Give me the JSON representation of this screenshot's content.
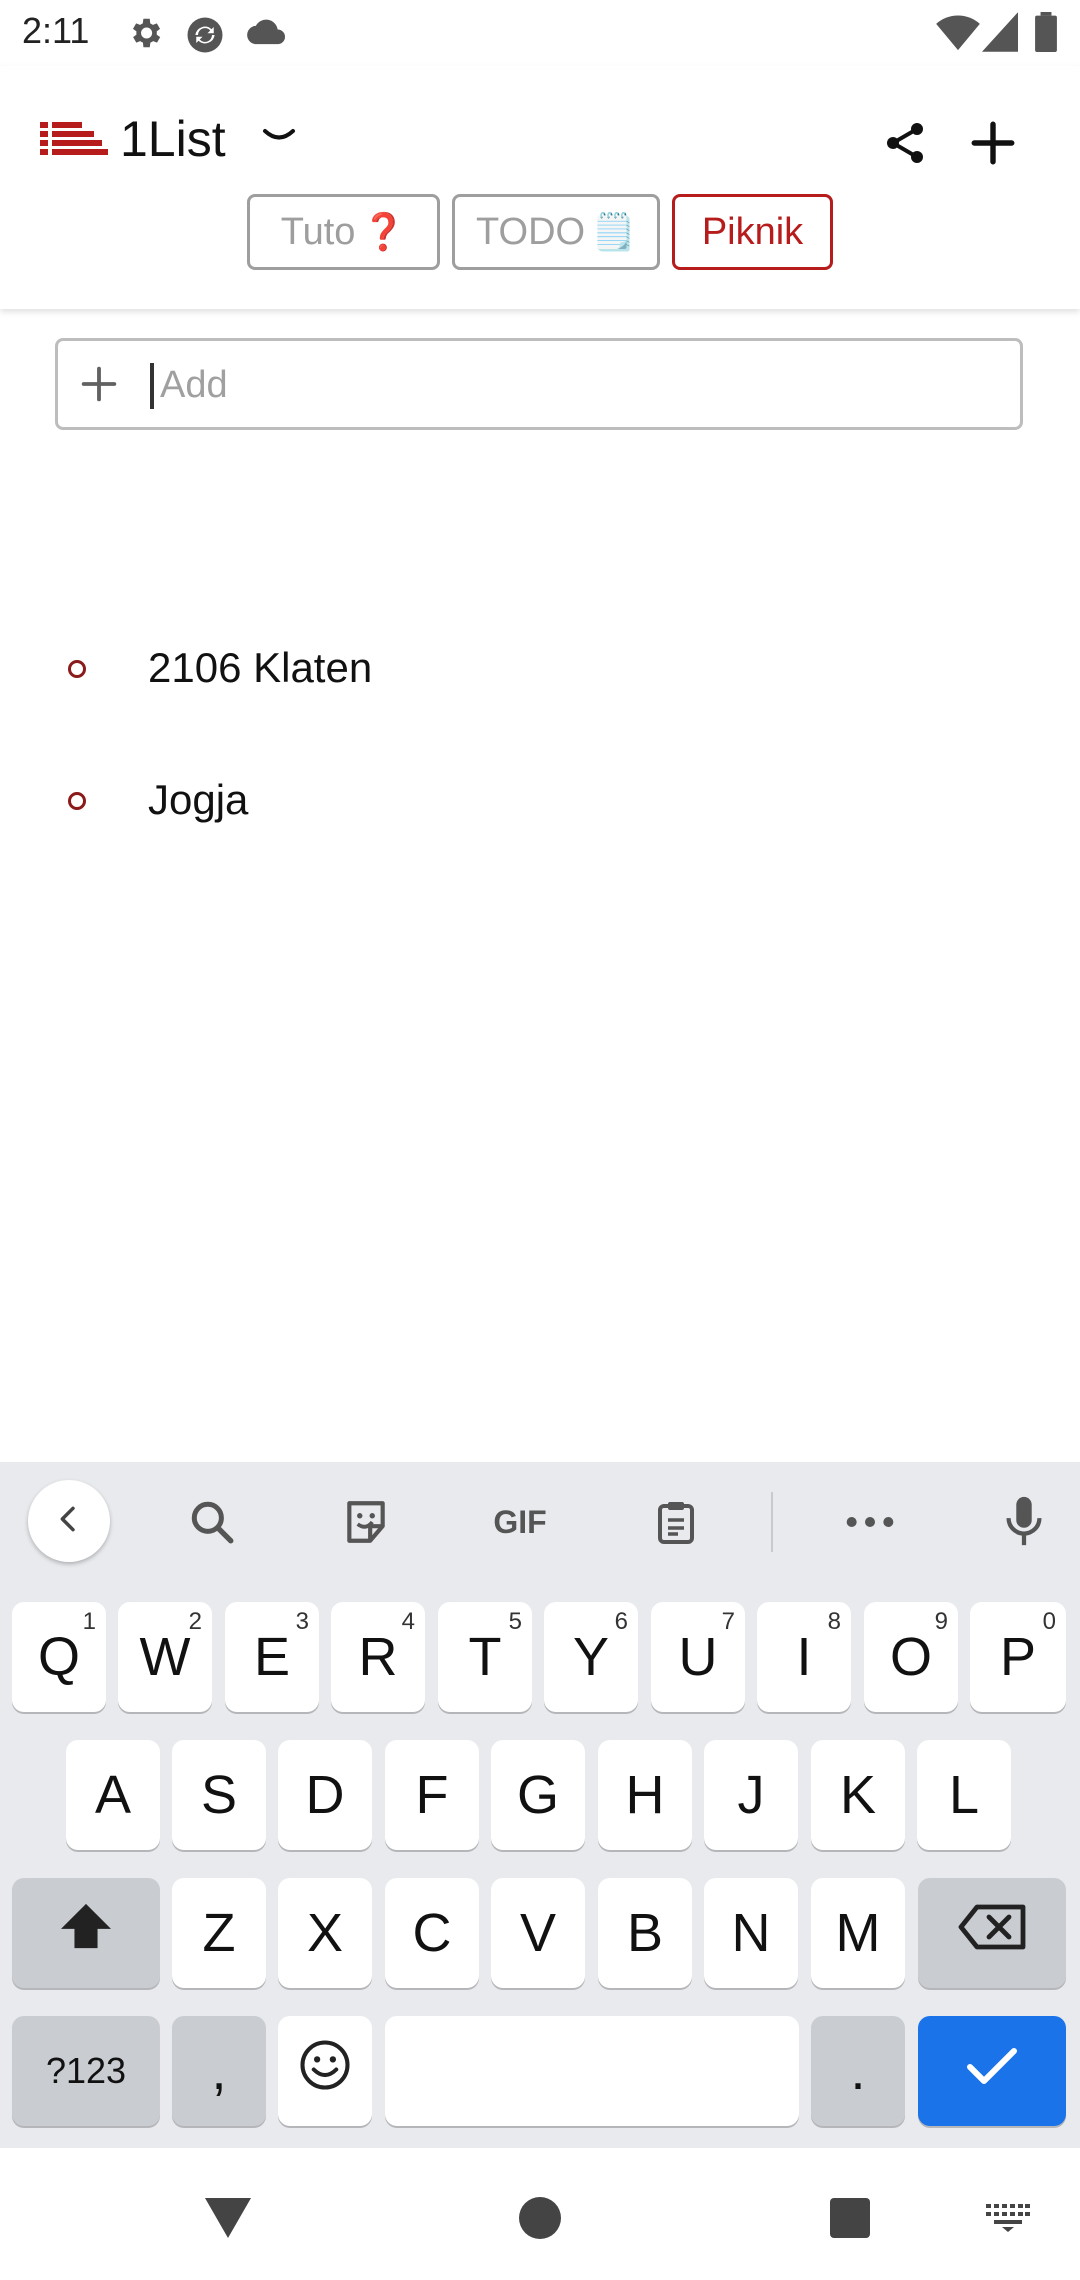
{
  "status_bar": {
    "time": "2:11",
    "left_icons": [
      "gear-icon",
      "sync-icon",
      "cloud-icon"
    ],
    "right_icons": [
      "wifi-icon",
      "signal-icon",
      "battery-icon"
    ]
  },
  "header": {
    "app_title": "1List",
    "actions": [
      "share-icon",
      "add-icon"
    ]
  },
  "tabs": [
    {
      "label": "Tuto",
      "emoji": "❓",
      "active": false
    },
    {
      "label": "TODO",
      "emoji": "🗒️",
      "active": false
    },
    {
      "label": "Piknik",
      "emoji": "",
      "active": true
    }
  ],
  "add_input": {
    "placeholder": "Add",
    "value": ""
  },
  "items": [
    {
      "text": "2106 Klaten"
    },
    {
      "text": "Jogja"
    }
  ],
  "keyboard": {
    "toolbar": [
      "back-icon",
      "search-icon",
      "sticker-icon",
      "gif-icon",
      "clipboard-icon",
      "more-icon",
      "mic-icon"
    ],
    "gif_label": "GIF",
    "row1": [
      {
        "k": "Q",
        "h": "1"
      },
      {
        "k": "W",
        "h": "2"
      },
      {
        "k": "E",
        "h": "3"
      },
      {
        "k": "R",
        "h": "4"
      },
      {
        "k": "T",
        "h": "5"
      },
      {
        "k": "Y",
        "h": "6"
      },
      {
        "k": "U",
        "h": "7"
      },
      {
        "k": "I",
        "h": "8"
      },
      {
        "k": "O",
        "h": "9"
      },
      {
        "k": "P",
        "h": "0"
      }
    ],
    "row2": [
      "A",
      "S",
      "D",
      "F",
      "G",
      "H",
      "J",
      "K",
      "L"
    ],
    "row3": [
      "Z",
      "X",
      "C",
      "V",
      "B",
      "N",
      "M"
    ],
    "symbols_label": "?123",
    "comma": ",",
    "period": "."
  },
  "accent_color": "#b71c1c",
  "keyboard_action_color": "#1a73e8"
}
